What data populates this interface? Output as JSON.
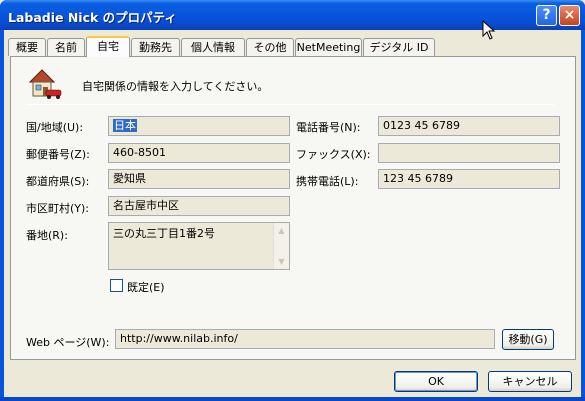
{
  "window": {
    "title": "Labadie Nick のプロパティ",
    "help_glyph": "?",
    "close_glyph": "×"
  },
  "tabs": [
    {
      "label": "概要"
    },
    {
      "label": "名前"
    },
    {
      "label": "自宅"
    },
    {
      "label": "勤務先"
    },
    {
      "label": "個人情報"
    },
    {
      "label": "その他"
    },
    {
      "label": "NetMeeting"
    },
    {
      "label": "デジタル ID"
    }
  ],
  "active_tab": "自宅",
  "intro": "自宅関係の情報を入力してください。",
  "fields": {
    "country_label": "国/地域(U):",
    "country_value": "日本",
    "zip_label": "郵便番号(Z):",
    "zip_value": "460-8501",
    "pref_label": "都道府県(S):",
    "pref_value": "愛知県",
    "city_label": "市区町村(Y):",
    "city_value": "名古屋市中区",
    "street_label": "番地(R):",
    "street_value": "三の丸三丁目1番2号",
    "phone_label": "電話番号(N):",
    "phone_value": "0123 45 6789",
    "fax_label": "ファックス(X):",
    "fax_value": "",
    "mobile_label": "携帯電話(L):",
    "mobile_value": "123 45 6789",
    "default_label": "既定(E)",
    "web_label": "Web ページ(W):",
    "web_value": "http://www.nilab.info/",
    "go_button": "移動(G)"
  },
  "buttons": {
    "ok": "OK",
    "cancel": "キャンセル"
  }
}
